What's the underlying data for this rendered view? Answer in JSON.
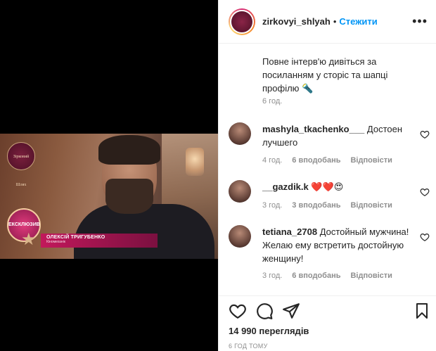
{
  "header": {
    "username": "zirkovyi_shlyah",
    "separator": "•",
    "follow_label": "Стежити",
    "more_label": "•••"
  },
  "video": {
    "logo_text": "Зірковий Шлях",
    "exclusive_label": "ЕКСКЛЮЗИВ",
    "name_line": "ОЛЕКСІЙ ТРИГУБЕНКО",
    "name_subline": "Кіномеханік"
  },
  "caption": {
    "text": "Повне інтерв'ю дивіться за посиланням у сторіс та шапці профілю 🔦",
    "time": "6 год."
  },
  "comments": [
    {
      "user": "mashyla_tkachenko___",
      "text": "Достоен лучшего",
      "time": "4 год.",
      "likes": "6 вподобань",
      "reply": "Відповісти"
    },
    {
      "user": "__gazdik.k",
      "text": "❤️❤️😍",
      "time": "3 год.",
      "likes": "3 вподобань",
      "reply": "Відповісти"
    },
    {
      "user": "tetiana_2708",
      "text": "Достойный мужчина! Желаю ему встретить достойную женщину!",
      "time": "3 год.",
      "likes": "6 вподобань",
      "reply": "Відповісти"
    }
  ],
  "footer": {
    "views": "14 990 переглядів",
    "ago": "6 ГОД ТОМУ"
  },
  "colors": {
    "accent": "#0095f6",
    "muted": "#8e8e8e",
    "text": "#262626"
  },
  "icons": [
    "heart-icon",
    "comment-icon",
    "share-icon",
    "bookmark-icon",
    "more-icon"
  ]
}
